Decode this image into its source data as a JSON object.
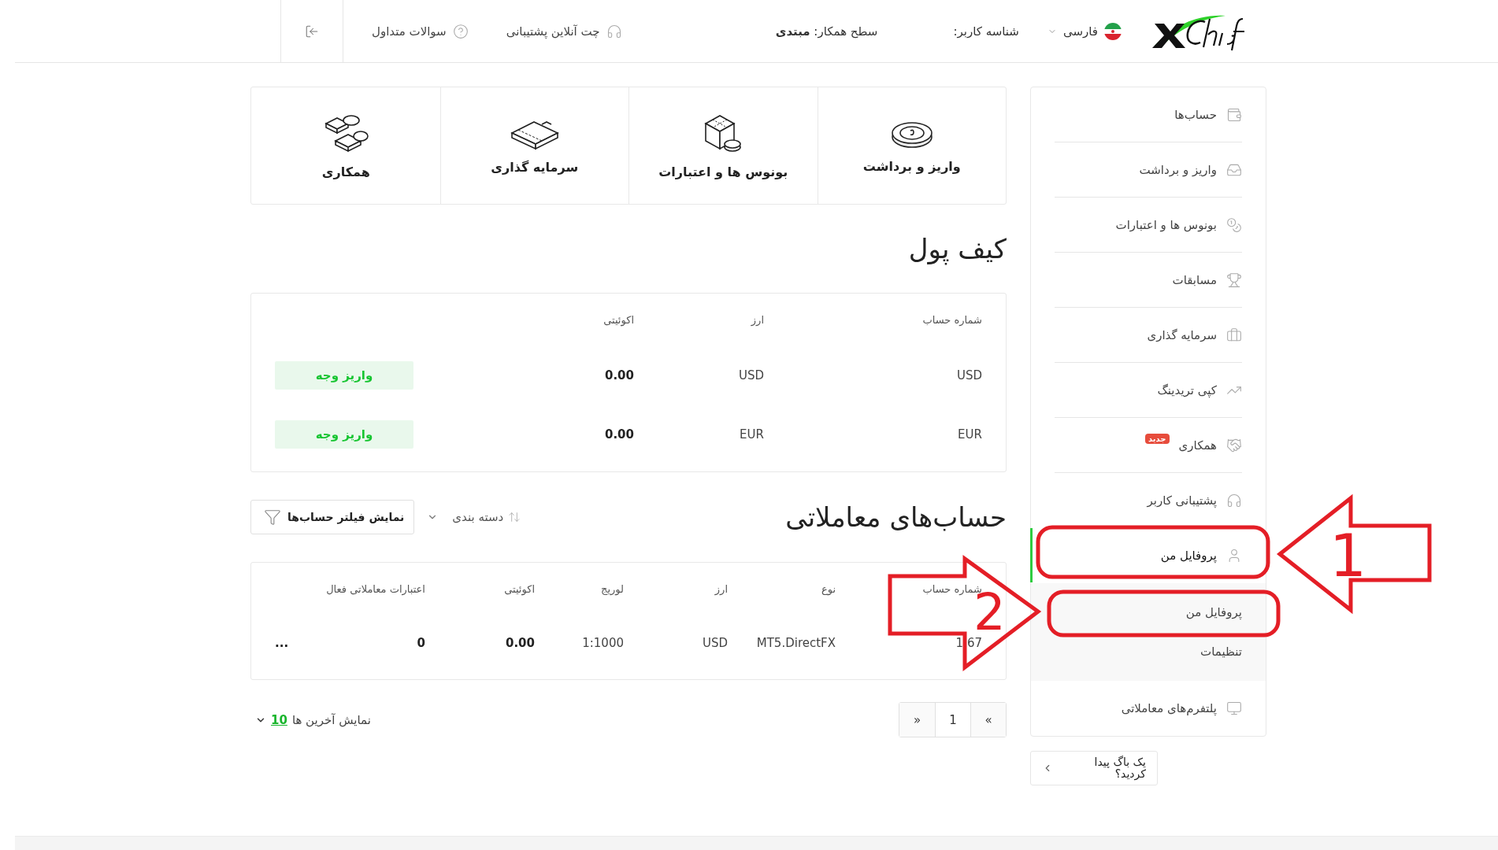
{
  "header": {
    "language": "فارسی",
    "user_id": "شناسه کاربر:",
    "partner_level": "سطح همکار: **مبتدی**",
    "support_chat": "چت آنلاین پشتیبانی",
    "faq": "سوالات متداول"
  },
  "sidebar": {
    "items": [
      {
        "label": "حساب‌ها",
        "selected": false
      },
      {
        "label": "واریز و برداشت",
        "selected": false
      },
      {
        "label": "بونوس ها و اعتبارات",
        "selected": false
      },
      {
        "label": "مسابقات",
        "selected": false
      },
      {
        "label": "سرمایه گذاری",
        "selected": false
      },
      {
        "label": "کپی تریدینگ",
        "selected": false
      },
      {
        "label": "همکاری",
        "selected": false,
        "badge": "جدید"
      },
      {
        "label": "پشتیبانی کاربر",
        "selected": false
      },
      {
        "label": "پروفایل من",
        "selected": true,
        "expanded": true,
        "children": [
          {
            "label": "پروفایل من"
          },
          {
            "label": "تنظیمات"
          }
        ]
      },
      {
        "label": "پلتفرم‌های معاملاتی",
        "selected": false
      }
    ],
    "bug_button": "یک باگ پیدا کردید؟"
  },
  "quick_cards": [
    {
      "label": "واریز و برداشت"
    },
    {
      "label": "بونوس ها و اعتبارات"
    },
    {
      "label": "سرمایه گذاری"
    },
    {
      "label": "همکاری"
    }
  ],
  "wallet": {
    "title": "کیف پول",
    "columns": [
      "شماره حساب",
      "ارز",
      "اکوئیتی"
    ],
    "rows": [
      {
        "account": "USD",
        "currency": "USD",
        "equity": "0.00",
        "action": "واریز وجه"
      },
      {
        "account": "EUR",
        "currency": "EUR",
        "equity": "0.00",
        "action": "واریز وجه"
      }
    ]
  },
  "trading_accounts": {
    "title": "حساب‌های معاملاتی",
    "sort": "دسته بندی",
    "filter_button": "نمایش فیلتر حساب‌ها",
    "columns": [
      "شماره حساب",
      "نوع",
      "ارز",
      "لوریج",
      "اکوئیتی",
      "اعتبارات معاملاتی فعال"
    ],
    "rows": [
      {
        "cells": [
          "1 67",
          "MT5.DirectFX",
          "USD",
          "1:1000",
          "0.00",
          "0"
        ],
        "menu": "..."
      }
    ],
    "pagination": {
      "prev": "«",
      "pages": [
        {
          "label": "1"
        }
      ],
      "next": "»"
    },
    "show_last": {
      "label": "نمایش آخرین ها",
      "count": "10"
    }
  },
  "annotations": [
    {
      "kind": "arrow-left",
      "label": "1"
    },
    {
      "kind": "arrow-right",
      "label": "2"
    }
  ]
}
